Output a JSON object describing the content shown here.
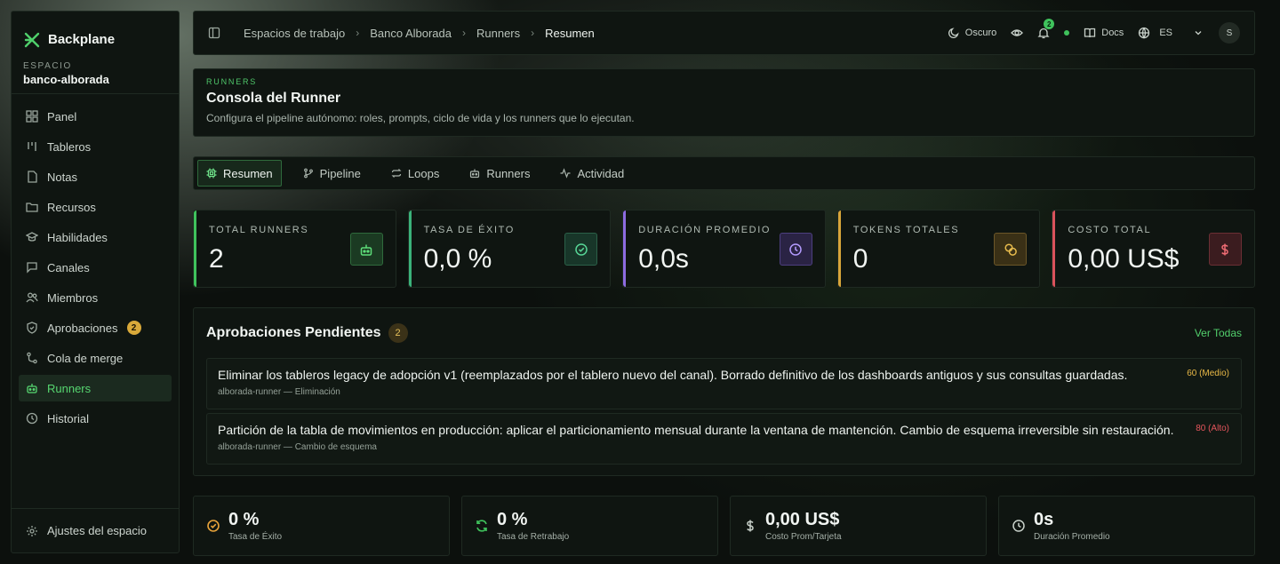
{
  "brand": {
    "name": "Backplane"
  },
  "workspace": {
    "label": "ESPACIO",
    "name": "banco-alborada"
  },
  "sidebar": {
    "items": [
      {
        "label": "Panel",
        "icon": "grid-icon"
      },
      {
        "label": "Tableros",
        "icon": "columns-icon"
      },
      {
        "label": "Notas",
        "icon": "file-icon"
      },
      {
        "label": "Recursos",
        "icon": "folder-icon"
      },
      {
        "label": "Habilidades",
        "icon": "graduation-cap-icon"
      },
      {
        "label": "Canales",
        "icon": "chat-icon"
      },
      {
        "label": "Miembros",
        "icon": "users-icon"
      },
      {
        "label": "Aprobaciones",
        "icon": "shield-icon",
        "badge": "2"
      },
      {
        "label": "Cola de merge",
        "icon": "merge-icon"
      },
      {
        "label": "Runners",
        "icon": "bot-icon",
        "active": true
      },
      {
        "label": "Historial",
        "icon": "clock-icon"
      }
    ],
    "footer_label": "Ajustes del espacio"
  },
  "topbar": {
    "breadcrumbs": [
      "Espacios de trabajo",
      "Banco Alborada",
      "Runners",
      "Resumen"
    ],
    "theme_label": "Oscuro",
    "notifications_count": "2",
    "docs_label": "Docs",
    "language": "ES",
    "avatar_initial": "S"
  },
  "header": {
    "eyebrow": "RUNNERS",
    "title": "Consola del Runner",
    "subtitle": "Configura el pipeline autónomo: roles, prompts, ciclo de vida y los runners que lo ejecutan."
  },
  "tabs": [
    {
      "label": "Resumen",
      "active": true
    },
    {
      "label": "Pipeline"
    },
    {
      "label": "Loops"
    },
    {
      "label": "Runners"
    },
    {
      "label": "Actividad"
    }
  ],
  "stats": [
    {
      "label": "TOTAL RUNNERS",
      "value": "2",
      "accent": "#3fc25c"
    },
    {
      "label": "TASA DE ÉXITO",
      "value": "0,0 %",
      "accent": "#3bb27a"
    },
    {
      "label": "DURACIÓN PROMEDIO",
      "value": "0,0s",
      "accent": "#8d6be0"
    },
    {
      "label": "TOKENS TOTALES",
      "value": "0",
      "accent": "#d8a53a"
    },
    {
      "label": "COSTO TOTAL",
      "value": "0,00 US$",
      "accent": "#d9525b"
    }
  ],
  "approvals": {
    "title": "Aprobaciones Pendientes",
    "count": "2",
    "view_all": "Ver Todas",
    "items": [
      {
        "title": "Eliminar los tableros legacy de adopción v1 (reemplazados por el tablero nuevo del canal). Borrado definitivo de los dashboards antiguos y sus consultas guardadas.",
        "meta": "alborada-runner — Eliminación",
        "risk": "60 (Medio)",
        "risk_color": "#e8b846"
      },
      {
        "title": "Partición de la tabla de movimientos en producción: aplicar el particionamiento mensual durante la ventana de mantención. Cambio de esquema irreversible sin restauración.",
        "meta": "alborada-runner — Cambio de esquema",
        "risk": "80 (Alto)",
        "risk_color": "#e4555c"
      }
    ]
  },
  "metrics": [
    {
      "value": "0 %",
      "label": "Tasa de Éxito",
      "color": "#e8a33a"
    },
    {
      "value": "0 %",
      "label": "Tasa de Retrabajo",
      "color": "#3fc25c"
    },
    {
      "value": "0,00 US$",
      "label": "Costo Prom/Tarjeta",
      "color": "#c9d2cb"
    },
    {
      "value": "0s",
      "label": "Duración Promedio",
      "color": "#c9d2cb"
    }
  ]
}
